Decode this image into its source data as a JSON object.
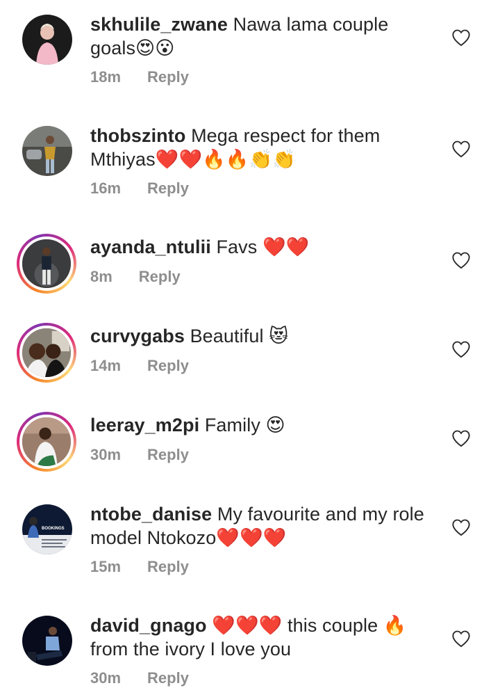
{
  "comments": [
    {
      "username": "skhulile_zwane",
      "text": "Nawa lama couple goals",
      "emojis": "😍😮",
      "time": "18m",
      "reply": "Reply"
    },
    {
      "username": "thobszinto",
      "text": "Mega respect for them Mthiyas",
      "emojis": "❤️❤️🔥🔥👏👏",
      "time": "16m",
      "reply": "Reply"
    },
    {
      "username": "ayanda_ntulii",
      "text": "Favs",
      "emojis": "❤️❤️",
      "time": "8m",
      "reply": "Reply"
    },
    {
      "username": "curvygabs",
      "text": "Beautiful",
      "emojis": "😻",
      "time": "14m",
      "reply": "Reply"
    },
    {
      "username": "leeray_m2pi",
      "text": "Family",
      "emojis": "😍",
      "time": "30m",
      "reply": "Reply"
    },
    {
      "username": "ntobe_danise",
      "text": "My favourite and my role model Ntokozo",
      "emojis": "❤️❤️❤️",
      "time": "15m",
      "reply": "Reply"
    },
    {
      "username": "david_gnago",
      "text_pre_emojis": "❤️❤️❤️",
      "text": "this couple",
      "emojis": "🔥",
      "text_post": "from the ivory I love you",
      "time": "30m",
      "reply": "Reply"
    }
  ],
  "avatar_thumb_text": "BOOKINGS",
  "icons": {
    "like": "heart-outline-icon"
  }
}
